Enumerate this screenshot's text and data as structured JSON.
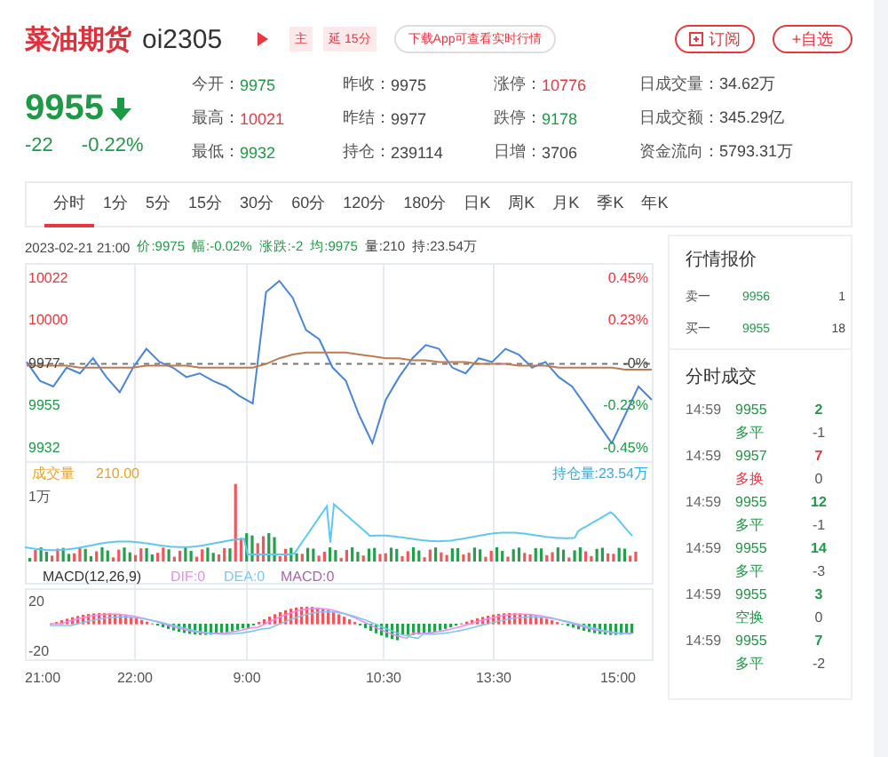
{
  "header": {
    "name": "菜油期货",
    "code": "oi2305",
    "badges": [
      {
        "text": "主"
      },
      {
        "text": "延 15分"
      }
    ],
    "notice": "下载App可查看实时行情",
    "buttons": [
      {
        "label": "订阅",
        "kind": "subscribe"
      },
      {
        "label": "+自选",
        "kind": "plain"
      }
    ]
  },
  "quote": {
    "price": "9955",
    "change": "-22",
    "change_pct": "-0.22%",
    "color": "#1e9a45"
  },
  "stats": [
    {
      "label": "今开：",
      "value": "9975",
      "color": "#1e9a45"
    },
    {
      "label": "昨收：",
      "value": "9975",
      "color": "#444444"
    },
    {
      "label": "涨停：",
      "value": "10776",
      "color": "#e8383d"
    },
    {
      "label": "日成交量：",
      "value": "34.62万",
      "color": "#444444"
    },
    {
      "label": "最高：",
      "value": "10021",
      "color": "#e8383d"
    },
    {
      "label": "昨结：",
      "value": "9977",
      "color": "#444444"
    },
    {
      "label": "跌停：",
      "value": "9178",
      "color": "#1e9a45"
    },
    {
      "label": "日成交额：",
      "value": "345.29亿",
      "color": "#444444"
    },
    {
      "label": "最低：",
      "value": "9932",
      "color": "#1e9a45"
    },
    {
      "label": "持仓：",
      "value": "239114",
      "color": "#444444"
    },
    {
      "label": "日增：",
      "value": "3706",
      "color": "#444444"
    },
    {
      "label": "资金流向：",
      "value": "5793.31万",
      "color": "#444444"
    }
  ],
  "tabs": [
    {
      "label": "分时",
      "selected": true
    },
    {
      "label": "1分",
      "selected": false
    },
    {
      "label": "5分",
      "selected": false
    },
    {
      "label": "15分",
      "selected": false
    },
    {
      "label": "30分",
      "selected": false
    },
    {
      "label": "60分",
      "selected": false
    },
    {
      "label": "120分",
      "selected": false
    },
    {
      "label": "180分",
      "selected": false
    },
    {
      "label": "日K",
      "selected": false
    },
    {
      "label": "周K",
      "selected": false
    },
    {
      "label": "月K",
      "selected": false
    },
    {
      "label": "季K",
      "selected": false
    },
    {
      "label": "年K",
      "selected": false
    }
  ],
  "info_line": [
    {
      "text": "2023-02-21 21:00",
      "color": "#444444"
    },
    {
      "text": "价:9975",
      "color": "#1e9a45"
    },
    {
      "text": "幅:-0.02%",
      "color": "#1e9a45"
    },
    {
      "text": "涨跌:-2",
      "color": "#1e9a45"
    },
    {
      "text": "均:9975",
      "color": "#1e9a45"
    },
    {
      "text": "量:210",
      "color": "#444444"
    },
    {
      "text": "持:23.54万",
      "color": "#444444"
    }
  ],
  "price_chart": {
    "chart_data": {
      "type": "line",
      "ylim": [
        9925,
        10030
      ],
      "yticks": [
        10022,
        10000,
        9977,
        9955,
        9932
      ],
      "grid": true,
      "series": [
        {
          "color": "#4a86d8",
          "values": [
            9978,
            9968,
            9965,
            9975,
            9972,
            9980,
            9970,
            9962,
            9975,
            9985,
            9978,
            9975,
            9970,
            9972,
            9968,
            9965,
            9960,
            9956,
            10015,
            10021,
            10012,
            9995,
            9990,
            9975,
            9968,
            9950,
            9935,
            9958,
            9970,
            9980,
            9987,
            9985,
            9975,
            9972,
            9980,
            9978,
            9985,
            9982,
            9975,
            9978,
            9970,
            9965,
            9955,
            9945,
            9935,
            9950,
            9965,
            9958
          ]
        },
        {
          "color": "#c07a50",
          "values": [
            9976,
            9976,
            9976,
            9976,
            9975,
            9975,
            9975,
            9975,
            9975,
            9976,
            9976,
            9976,
            9976,
            9975,
            9975,
            9975,
            9975,
            9975,
            9977,
            9980,
            9982,
            9983,
            9983,
            9983,
            9983,
            9982,
            9981,
            9980,
            9980,
            9979,
            9979,
            9978,
            9978,
            9978,
            9977,
            9977,
            9977,
            9976,
            9976,
            9976,
            9975,
            9975,
            9975,
            9975,
            9975,
            9974,
            9974,
            9974
          ]
        }
      ]
    },
    "right_ticks": [
      {
        "label": "0.45%",
        "color": "#e8383d"
      },
      {
        "label": "0.23%",
        "color": "#e8383d"
      },
      {
        "label": "-0%",
        "color": "#444444"
      },
      {
        "label": "-0.23%",
        "color": "#1e9a45"
      },
      {
        "label": "-0.45%",
        "color": "#1e9a45"
      }
    ]
  },
  "time_axis": [
    "21:00",
    "22:00",
    "9:00",
    "10:30",
    "13:30",
    "15:00"
  ],
  "volume_chart": {
    "label": "成交量",
    "value": "210.00",
    "open_interest": "持仓量:23.54万",
    "axis_label": "1万"
  },
  "macd_chart": {
    "title": "MACD(12,26,9)",
    "legend": [
      {
        "text": "DIF:0",
        "color": "#f08af0"
      },
      {
        "text": "DEA:0",
        "color": "#7cc8f5"
      },
      {
        "text": "MACD:0",
        "color": "#b060b0"
      }
    ],
    "ticks": [
      "20",
      "-20"
    ]
  },
  "quote_panel": {
    "title": "行情报价",
    "orders": [
      {
        "label": "卖一",
        "price": "9956",
        "volume": "1"
      },
      {
        "label": "买一",
        "price": "9955",
        "volume": "18"
      }
    ]
  },
  "trades_panel": {
    "title": "分时成交",
    "trades": [
      {
        "time": "14:59",
        "price": "9955",
        "volume": {
          "text": "2",
          "color": "#1e9a45"
        },
        "type": {
          "text": "多平",
          "color": "#1e9a45"
        },
        "change": "-1"
      },
      {
        "time": "14:59",
        "price": "9957",
        "volume": {
          "text": "7",
          "color": "#e8383d"
        },
        "type": {
          "text": "多换",
          "color": "#e8383d"
        },
        "change": "0"
      },
      {
        "time": "14:59",
        "price": "9955",
        "volume": {
          "text": "12",
          "color": "#1e9a45"
        },
        "type": {
          "text": "多平",
          "color": "#1e9a45"
        },
        "change": "-1"
      },
      {
        "time": "14:59",
        "price": "9955",
        "volume": {
          "text": "14",
          "color": "#1e9a45"
        },
        "type": {
          "text": "多平",
          "color": "#1e9a45"
        },
        "change": "-3"
      },
      {
        "time": "14:59",
        "price": "9955",
        "volume": {
          "text": "3",
          "color": "#1e9a45"
        },
        "type": {
          "text": "空换",
          "color": "#1e9a45"
        },
        "change": "0"
      },
      {
        "time": "14:59",
        "price": "9955",
        "volume": {
          "text": "7",
          "color": "#1e9a45"
        },
        "type": {
          "text": "多平",
          "color": "#1e9a45"
        },
        "change": "-2"
      }
    ]
  }
}
